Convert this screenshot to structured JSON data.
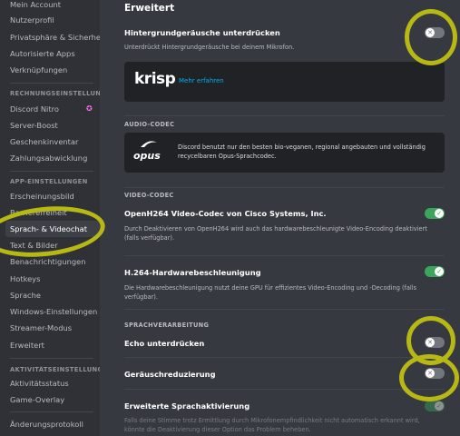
{
  "sidebar": {
    "items_top": [
      "Mein Account",
      "Nutzerprofil",
      "Privatsphäre & Sicherheit",
      "Autorisierte Apps",
      "Verknüpfungen"
    ],
    "billing_header": "RECHNUNGSEINSTELLUNG...",
    "billing_items": [
      "Discord Nitro",
      "Server-Boost",
      "Geschenkinventar",
      "Zahlungsabwicklung"
    ],
    "app_header": "APP-EINSTELLUNGEN",
    "app_items": [
      "Erscheinungsbild",
      "Barrierefreiheit",
      "Sprach- & Videochat",
      "Text & Bilder",
      "Benachrichtigungen",
      "Hotkeys",
      "Sprache",
      "Windows-Einstellungen",
      "Streamer-Modus",
      "Erweitert"
    ],
    "activity_header": "AKTIVITÄTSEINSTELLUNGEN",
    "activity_items": [
      "Aktivitätsstatus",
      "Game-Overlay"
    ],
    "changelog": "Änderungsprotokoll"
  },
  "main": {
    "title": "Erweitert",
    "noise": {
      "title": "Hintergrundgeräusche unterdrücken",
      "desc": "Unterdrückt Hintergrundgeräusche bei deinem Mikrofon.",
      "krisp_logo": "krisp",
      "krisp_link": "Mehr erfahren"
    },
    "audio_codec": {
      "header": "AUDIO-CODEC",
      "logo": "opus",
      "text": "Discord benutzt nur den besten bio-veganen, regional angebauten und vollständig recycelbaren Opus-Sprachcodec."
    },
    "video_codec": {
      "header": "VIDEO-CODEC",
      "openh264_title": "OpenH264 Video-Codec von Cisco Systems, Inc.",
      "openh264_desc": "Durch Deaktivieren von OpenH264 wird auch das hardwarebeschleunigte Video-Encoding deaktiviert (falls verfügbar).",
      "h264_title": "H.264-Hardwarebeschleunigung",
      "h264_desc": "Die Hardwarebeschleunigung nutzt deine GPU für effizientes Video-Encoding und -Decoding (falls verfügbar)."
    },
    "voice": {
      "header": "SPRACHVERARBEITUNG",
      "echo": "Echo unterdrücken",
      "noise_reduction": "Geräuschreduzierung",
      "advanced": "Erweiterte Sprachaktivierung",
      "advanced_desc": "Falls deine Stimme trotz Ermittlung durch Mikrofonempfindlichkeit nicht automatisch erkannt wird, könnte die Deaktivierung dieser Option das Problem beheben."
    }
  },
  "toggles": {
    "noise": "off",
    "openh264": "on",
    "h264": "on",
    "echo": "off",
    "noise_reduction": "off",
    "advanced": "on-disabled"
  },
  "colors": {
    "accent_link": "#00aff4",
    "toggle_on": "#3ba55c",
    "annotation": "#b8b814"
  }
}
